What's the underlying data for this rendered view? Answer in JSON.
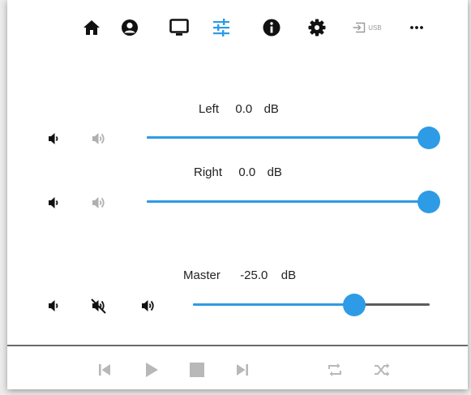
{
  "topbar": {
    "icons": [
      "home-icon",
      "account-icon",
      "monitor-icon",
      "sliders-icon",
      "info-icon",
      "gear-icon",
      "usb-input-icon",
      "more-icon"
    ],
    "usb_label": "USB",
    "active": "sliders-icon",
    "accent": "#2d9be5"
  },
  "channels": {
    "left": {
      "name": "Left",
      "value": "0.0",
      "unit": "dB",
      "level": 1.0
    },
    "right": {
      "name": "Right",
      "value": "0.0",
      "unit": "dB",
      "level": 1.0
    },
    "master": {
      "name": "Master",
      "value": "-25.0",
      "unit": "dB",
      "level": 0.68
    }
  },
  "transport": {
    "icons": [
      "previous-icon",
      "play-icon",
      "stop-icon",
      "next-icon",
      "repeat-icon",
      "shuffle-icon"
    ],
    "color": "#b8b8b8"
  },
  "colors": {
    "accent": "#2d9be5",
    "icon": "#111111",
    "disabled_icon": "#b0b0b0"
  }
}
